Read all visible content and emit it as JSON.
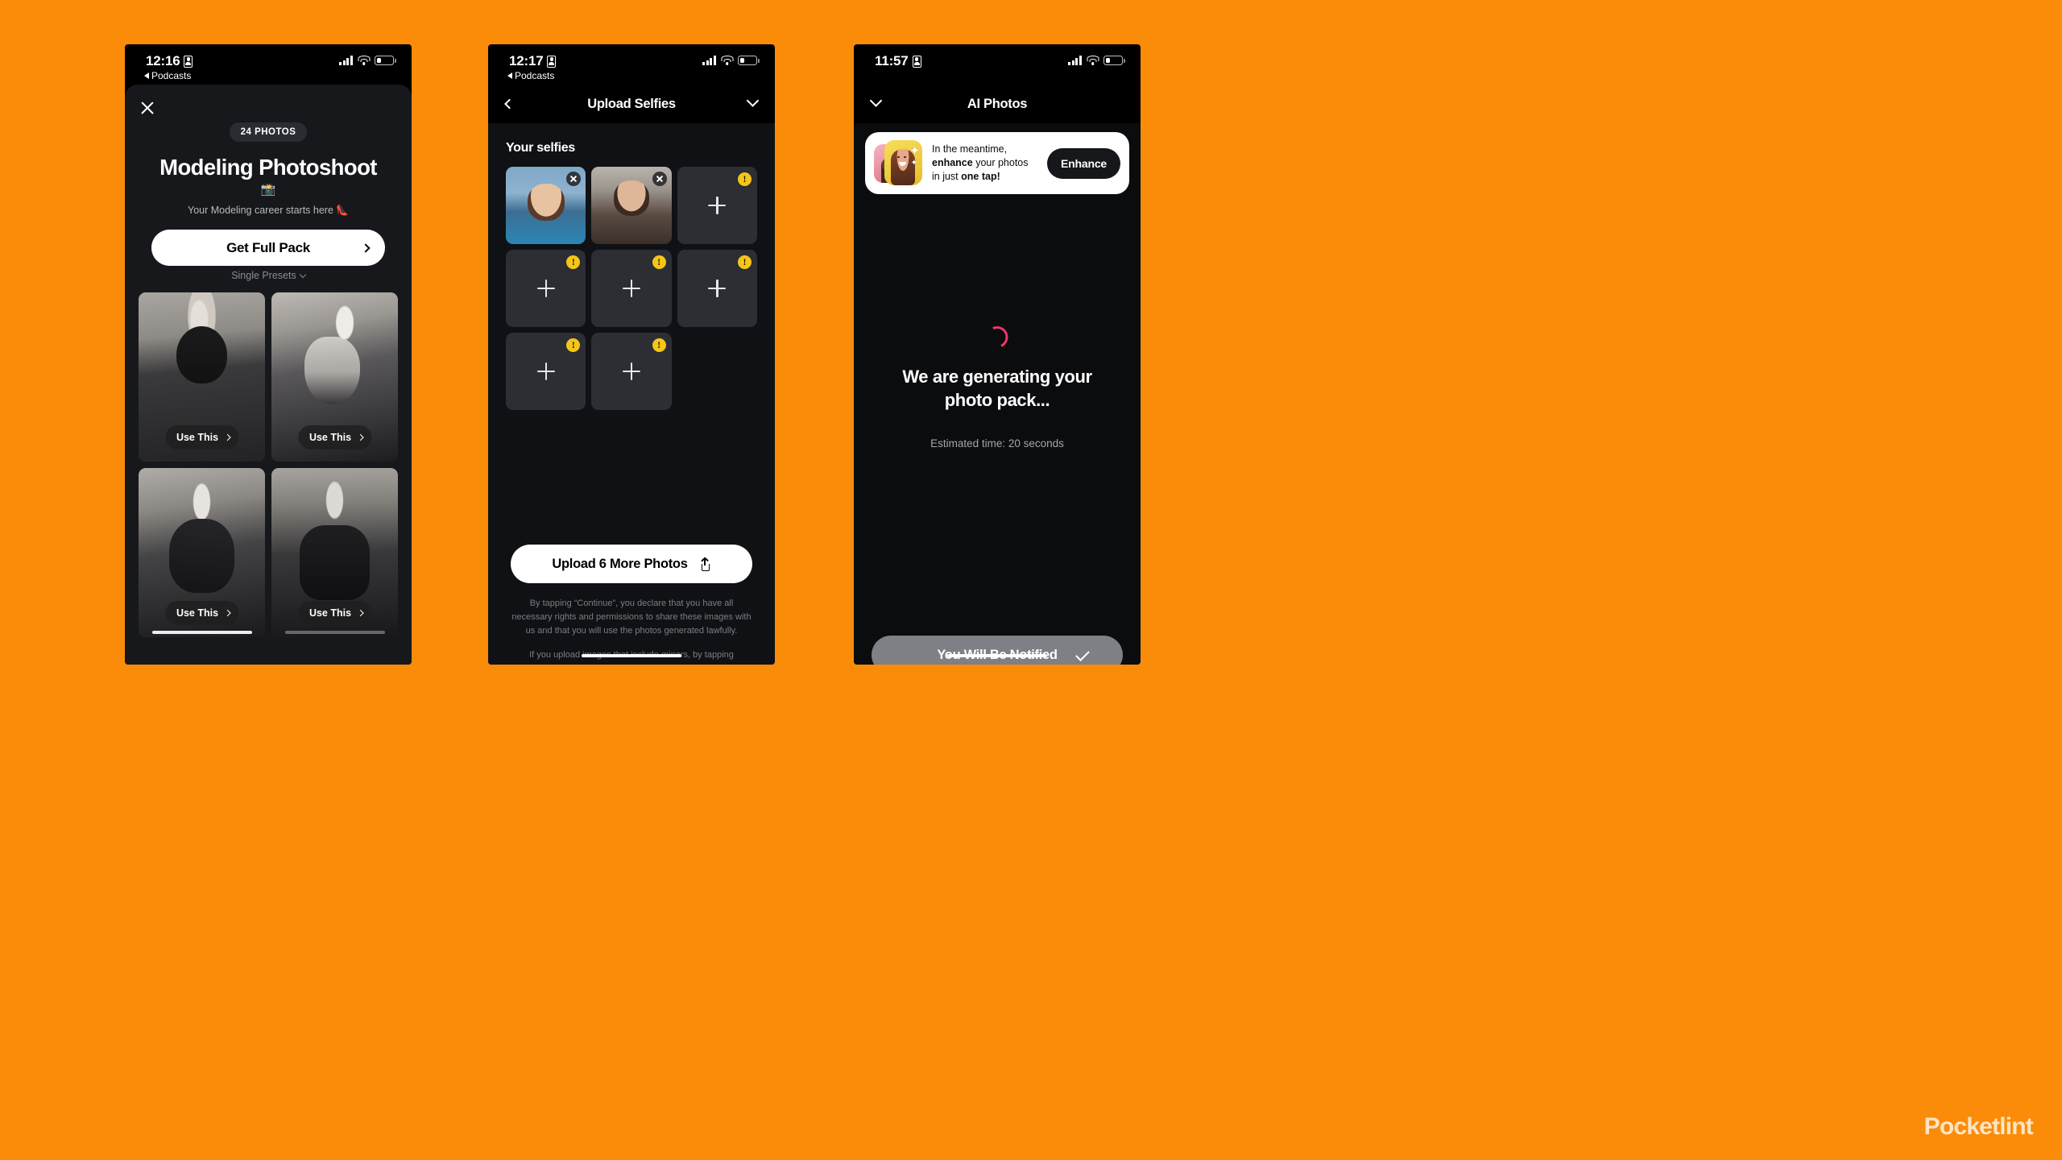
{
  "canvas": {
    "background": "#FA8C09"
  },
  "watermark": {
    "text": "Pocketlint"
  },
  "phones": {
    "one": {
      "status": {
        "time": "12:16",
        "back_app": "Podcasts",
        "lock_icon": "lock-portrait-icon",
        "signal_icon": "cellular-signal-icon",
        "wifi_icon": "wifi-icon",
        "battery_icon": "battery-icon"
      },
      "close_icon": "close-icon",
      "badge": "24 PHOTOS",
      "title": "Modeling Photoshoot",
      "emoji": "📸",
      "subtitle": "Your Modeling career starts here 👠",
      "cta": {
        "label": "Get Full Pack",
        "chevron_icon": "chevron-right-icon"
      },
      "presets": {
        "label": "Single Presets",
        "caret_icon": "chevron-down-icon"
      },
      "cards": [
        {
          "name": "preset-card-1",
          "use_label": "Use This",
          "chevron_icon": "chevron-right-icon"
        },
        {
          "name": "preset-card-2",
          "use_label": "Use This",
          "chevron_icon": "chevron-right-icon"
        },
        {
          "name": "preset-card-3",
          "use_label": "Use This",
          "chevron_icon": "chevron-right-icon"
        },
        {
          "name": "preset-card-4",
          "use_label": "Use This",
          "chevron_icon": "chevron-right-icon"
        }
      ]
    },
    "two": {
      "status": {
        "time": "12:17",
        "back_app": "Podcasts",
        "lock_icon": "lock-portrait-icon",
        "signal_icon": "cellular-signal-icon",
        "wifi_icon": "wifi-icon",
        "battery_icon": "battery-icon"
      },
      "header": {
        "title": "Upload Selfies",
        "back_icon": "chevron-left-icon",
        "collapse_icon": "chevron-down-icon"
      },
      "section_label": "Your selfies",
      "tiles": [
        {
          "type": "photo",
          "id": "selfie-1",
          "remove_icon": "close-icon"
        },
        {
          "type": "photo",
          "id": "selfie-2",
          "remove_icon": "close-icon"
        },
        {
          "type": "empty",
          "id": "slot-3",
          "warning_icon": "warning-icon",
          "add_icon": "plus-icon"
        },
        {
          "type": "empty",
          "id": "slot-4",
          "warning_icon": "warning-icon",
          "add_icon": "plus-icon"
        },
        {
          "type": "empty",
          "id": "slot-5",
          "warning_icon": "warning-icon",
          "add_icon": "plus-icon"
        },
        {
          "type": "empty",
          "id": "slot-6",
          "warning_icon": "warning-icon",
          "add_icon": "plus-icon"
        },
        {
          "type": "empty",
          "id": "slot-7",
          "warning_icon": "warning-icon",
          "add_icon": "plus-icon"
        },
        {
          "type": "empty",
          "id": "slot-8",
          "warning_icon": "warning-icon",
          "add_icon": "plus-icon"
        }
      ],
      "upload_button": {
        "label": "Upload 6 More Photos",
        "icon": "upload-icon"
      },
      "legal": [
        "By tapping “Continue”, you declare that you have all necessary rights and permissions to share these images with us and that you will use the photos generated lawfully.",
        "If you upload images that include minors, by tapping “Continue,” you declare that you have parental responsibility for them and the necessary rights to share the images."
      ],
      "home_indicator": "home-indicator"
    },
    "three": {
      "status": {
        "time": "11:57",
        "lock_icon": "lock-portrait-icon",
        "signal_icon": "cellular-signal-icon",
        "wifi_icon": "wifi-icon",
        "battery_icon": "battery-icon"
      },
      "header": {
        "title": "AI Photos",
        "collapse_icon": "chevron-down-icon"
      },
      "promo": {
        "line1": "In the meantime,",
        "line2_bold": "enhance",
        "line2_rest": " your photos",
        "line3_pre": "in just ",
        "line3_bold": "one tap!",
        "button_label": "Enhance",
        "thumb_front_icon": "enhanced-photo-thumbnail",
        "thumb_back_icon": "original-photo-thumbnail",
        "sparkle_icon": "sparkle-icon"
      },
      "spinner_icon": "loading-spinner",
      "generating_title": "We are generating your photo pack...",
      "estimate": "Estimated time: 20 seconds",
      "notify_button": {
        "label": "You Will Be Notified",
        "icon": "check-icon"
      },
      "home_indicator": "home-indicator"
    }
  },
  "colors": {
    "page_orange": "#FA8C09",
    "sheet_dark": "#17181C",
    "tile_dark": "#2C2E33",
    "warning_yellow": "#F5C518",
    "spinner_pink": "#F1356A",
    "notify_gray": "#7E8085",
    "white": "#FFFFFF"
  }
}
